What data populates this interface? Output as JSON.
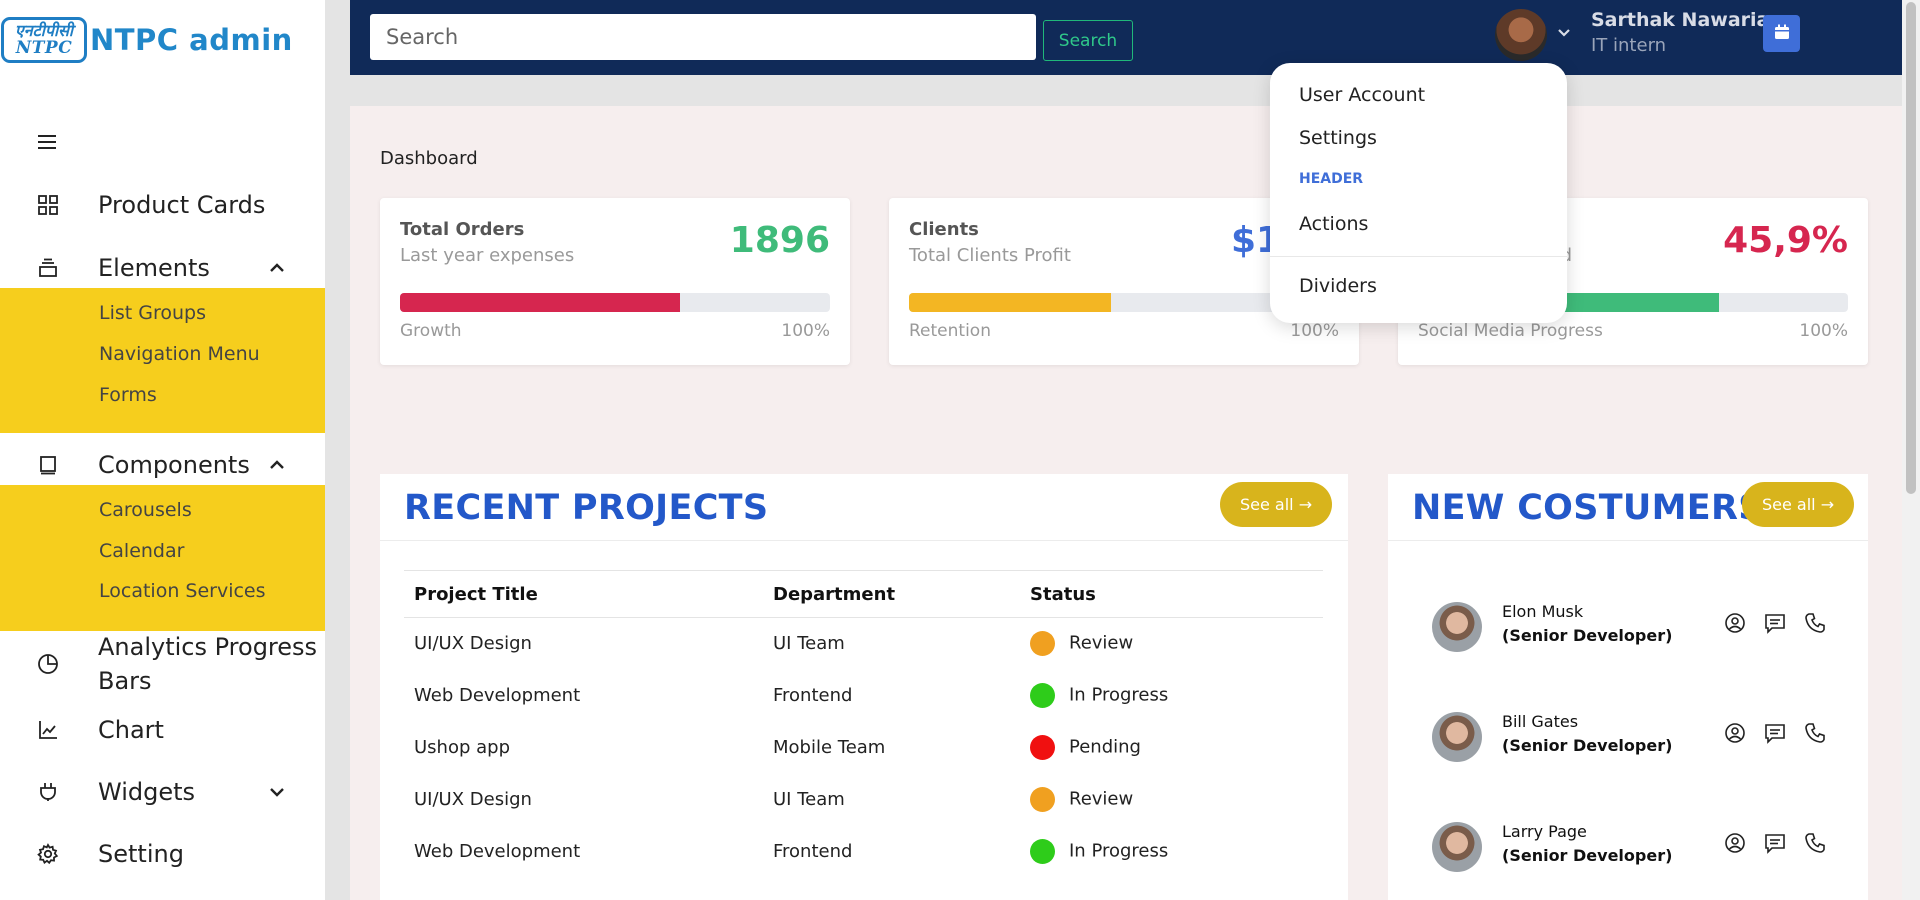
{
  "brand": {
    "logo_line1": "एनटीपीसी",
    "logo_line2": "NTPC",
    "name": "NTPC admin"
  },
  "sidebar": {
    "menu_icon": "hamburger-icon",
    "items": [
      {
        "label": "Product Cards",
        "icon": "grid-icon"
      },
      {
        "label": "Elements",
        "icon": "layers-icon",
        "chevron": "up"
      },
      {
        "label": "Components",
        "icon": "book-icon",
        "chevron": "up"
      },
      {
        "label": "Analytics Progress Bars",
        "icon": "pie-chart-icon"
      },
      {
        "label": "Chart",
        "icon": "line-chart-icon"
      },
      {
        "label": "Widgets",
        "icon": "plug-icon",
        "chevron": "down"
      },
      {
        "label": "Setting",
        "icon": "gear-icon"
      }
    ],
    "elements_sub": [
      "List Groups",
      "Navigation Menu",
      "Forms"
    ],
    "components_sub": [
      "Carousels",
      "Calendar",
      "Location Services"
    ],
    "submenu_color": "#f6ce1d"
  },
  "header": {
    "search_placeholder": "Search",
    "search_button": "Search",
    "user_name": "Sarthak Nawaria",
    "user_role": "IT intern",
    "calendar_icon": "calendar-icon"
  },
  "dropdown": {
    "items": [
      "User Account",
      "Settings"
    ],
    "header": "HEADER",
    "actions": "Actions",
    "dividers": "Dividers"
  },
  "main": {
    "breadcrumb": "Dashboard",
    "stats": [
      {
        "title": "Total Orders",
        "subtitle": "Last year expenses",
        "value": "1896",
        "value_color": "#3fbb7a",
        "bar_label": "Growth",
        "bar_max": "100%",
        "progress": 0.65,
        "bar_color": "#d6264f"
      },
      {
        "title": "Clients",
        "subtitle": "Total Clients Profit",
        "value": "$12",
        "value_color": "#3f6ed8",
        "bar_label": "Retention",
        "bar_max": "100%",
        "progress": 0.47,
        "bar_color": "#f3b623"
      },
      {
        "title": "",
        "subtitle": "d",
        "value": "45,9%",
        "value_color": "#d6264f",
        "bar_label": "Social Media Progress",
        "bar_max": "100%",
        "progress": 0.7,
        "bar_color": "#3fbb7a"
      }
    ],
    "projects": {
      "title": "RECENT PROJECTS",
      "see_all": "See all →",
      "columns": [
        "Project Title",
        "Department",
        "Status"
      ],
      "rows": [
        {
          "title": "UI/UX Design",
          "dept": "UI Team",
          "status": "Review",
          "color": "#f0a020"
        },
        {
          "title": "Web Development",
          "dept": "Frontend",
          "status": "In Progress",
          "color": "#2ecc1a"
        },
        {
          "title": "Ushop app",
          "dept": "Mobile Team",
          "status": "Pending",
          "color": "#f01010"
        },
        {
          "title": "UI/UX Design",
          "dept": "UI Team",
          "status": "Review",
          "color": "#f0a020"
        },
        {
          "title": "Web Development",
          "dept": "Frontend",
          "status": "In Progress",
          "color": "#2ecc1a"
        }
      ]
    },
    "customers": {
      "title": "NEW COSTUMERS",
      "see_all": "See all →",
      "list": [
        {
          "name": "Elon Musk",
          "role": "(Senior Developer)"
        },
        {
          "name": "Bill Gates",
          "role": "(Senior Developer)"
        },
        {
          "name": "Larry Page",
          "role": "(Senior Developer)"
        }
      ]
    }
  }
}
